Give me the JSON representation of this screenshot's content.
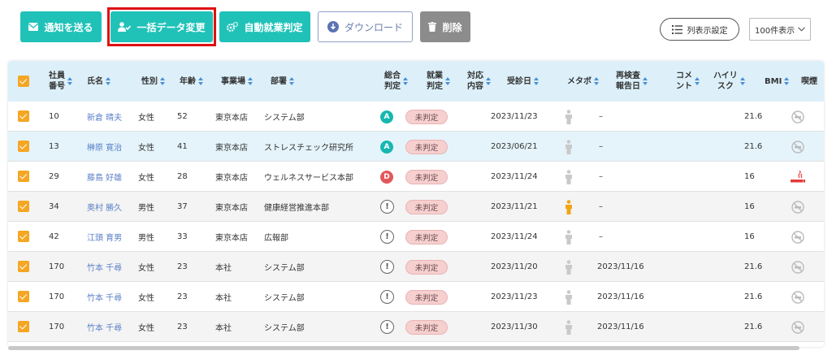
{
  "toolbar": {
    "send_notice": "通知を送る",
    "bulk_change": "一括データ変更",
    "auto_judge": "自動就業判定",
    "download": "ダウンロード",
    "delete": "削除",
    "column_settings": "列表示設定",
    "per_page": "100件表示"
  },
  "icons": [
    "envelope-icon",
    "user-check-icon",
    "gears-icon",
    "download-icon",
    "trash-icon",
    "list-icon",
    "chevron-down-icon",
    "person-icon",
    "no-smoking-icon",
    "cigarette-icon"
  ],
  "columns": {
    "emp_no": "社員\n番号",
    "name": "氏名",
    "gender": "性別",
    "age": "年齢",
    "office": "事業場",
    "dept": "部署",
    "overall": "総合\n判定",
    "work": "就業\n判定",
    "response": "対応\n内容",
    "exam_date": "受診日",
    "metabo": "メタボ",
    "recheck": "再検査\n報告日",
    "comment": "コメ\nント",
    "high_risk": "ハイリ\nスク",
    "bmi": "BMI",
    "smoking": "喫煙"
  },
  "rows": [
    {
      "emp_no": "10",
      "name": "新倉 晴夫",
      "gender": "女性",
      "age": "52",
      "office": "東京本店",
      "dept": "システム部",
      "overall": "A",
      "work": "未判定",
      "exam_date": "2023/11/23",
      "metabo": "none",
      "recheck": "–",
      "bmi": "21.6",
      "smoking": "no"
    },
    {
      "emp_no": "13",
      "name": "榊原 寛治",
      "gender": "女性",
      "age": "41",
      "office": "東京本店",
      "dept": "ストレスチェック研究所",
      "overall": "A",
      "work": "未判定",
      "exam_date": "2023/06/21",
      "metabo": "none",
      "recheck": "–",
      "bmi": "21.6",
      "smoking": "no"
    },
    {
      "emp_no": "29",
      "name": "藤島 好雄",
      "gender": "女性",
      "age": "28",
      "office": "東京本店",
      "dept": "ウェルネスサービス本部",
      "overall": "D",
      "work": "未判定",
      "exam_date": "2023/11/24",
      "metabo": "none",
      "recheck": "–",
      "bmi": "16",
      "smoking": "yes"
    },
    {
      "emp_no": "34",
      "name": "奥村 勝久",
      "gender": "男性",
      "age": "37",
      "office": "東京本店",
      "dept": "健康経営推進本部",
      "overall": "!",
      "work": "未判定",
      "exam_date": "2023/11/21",
      "metabo": "yes",
      "recheck": "–",
      "bmi": "16",
      "smoking": "no"
    },
    {
      "emp_no": "42",
      "name": "江頭 育男",
      "gender": "男性",
      "age": "33",
      "office": "東京本店",
      "dept": "広報部",
      "overall": "!",
      "work": "未判定",
      "exam_date": "2023/11/24",
      "metabo": "none",
      "recheck": "–",
      "bmi": "16",
      "smoking": "no"
    },
    {
      "emp_no": "170",
      "name": "竹本 千尋",
      "gender": "女性",
      "age": "23",
      "office": "本社",
      "dept": "システム部",
      "overall": "!",
      "work": "未判定",
      "exam_date": "2023/11/20",
      "metabo": "none",
      "recheck": "2023/11/16",
      "bmi": "21.6",
      "smoking": "no"
    },
    {
      "emp_no": "170",
      "name": "竹本 千尋",
      "gender": "女性",
      "age": "23",
      "office": "本社",
      "dept": "システム部",
      "overall": "!",
      "work": "未判定",
      "exam_date": "2023/11/23",
      "metabo": "none",
      "recheck": "2023/11/16",
      "bmi": "21.6",
      "smoking": "no"
    },
    {
      "emp_no": "170",
      "name": "竹本 千尋",
      "gender": "女性",
      "age": "23",
      "office": "本社",
      "dept": "システム部",
      "overall": "!",
      "work": "未判定",
      "exam_date": "2023/11/30",
      "metabo": "none",
      "recheck": "2023/11/16",
      "bmi": "21.6",
      "smoking": "no"
    }
  ],
  "colors": {
    "teal": "#20c2b8",
    "orange": "#f5a623",
    "highlight": "#e01010",
    "badge_a": "#17b7b0",
    "badge_d": "#e2585c"
  }
}
